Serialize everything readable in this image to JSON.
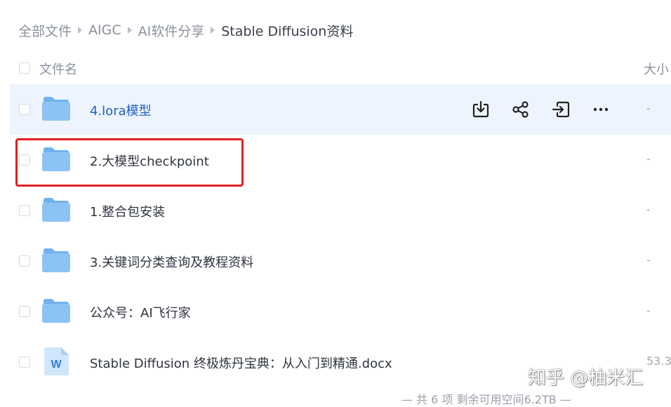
{
  "breadcrumb": [
    "全部文件",
    "AIGC",
    "AI软件分享",
    "Stable Diffusion资料"
  ],
  "header": {
    "name_label": "文件名",
    "size_label": "大小"
  },
  "files": [
    {
      "name": "4.lora模型",
      "size": "-",
      "type": "folder",
      "hovered": true
    },
    {
      "name": "2.大模型checkpoint",
      "size": "-",
      "type": "folder",
      "highlighted": true
    },
    {
      "name": "1.整合包安装",
      "size": "-",
      "type": "folder"
    },
    {
      "name": "3.关键词分类查询及教程资料",
      "size": "-",
      "type": "folder"
    },
    {
      "name": "公众号：AI飞行家",
      "size": "-",
      "type": "folder"
    },
    {
      "name": "Stable Diffusion 终极炼丹宝典：从入门到精通.docx",
      "size": "53.3",
      "type": "docx",
      "icon_letter": "W"
    }
  ],
  "row_actions": [
    "download-icon",
    "share-icon",
    "move-icon",
    "more-icon"
  ],
  "footer": "— 共 6 项 剩余可用空间6.2TB —",
  "watermark": "知乎 @柚米汇",
  "colors": {
    "accent": "#1f5fbf",
    "hover_row": "#eef4fd",
    "highlight": "#e02020",
    "folder": "#8cc3f4"
  }
}
